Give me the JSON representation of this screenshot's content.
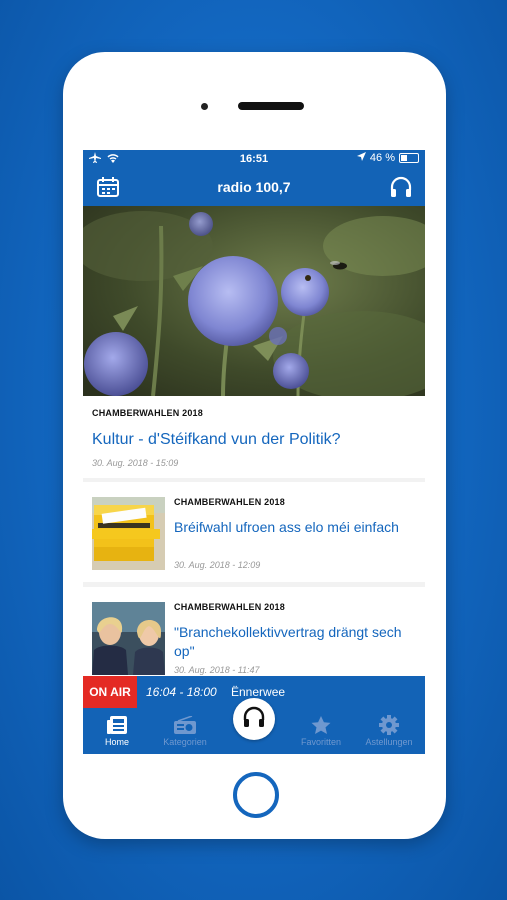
{
  "status_bar": {
    "time": "16:51",
    "battery": "46 %",
    "battery_level": 0.46
  },
  "nav": {
    "title": "radio 100,7",
    "calendar_icon": "calendar-icon",
    "headphones_icon": "headphones-icon"
  },
  "hero": {
    "category": "CHAMBERWAHLEN 2018",
    "title": "Kultur  - d'Stéifkand vun der Politik?",
    "date": "30. Aug. 2018 - 15:09"
  },
  "articles": [
    {
      "category": "CHAMBERWAHLEN 2018",
      "title": "Bréifwahl ufroen ass elo méi einfach",
      "date": "30. Aug. 2018 - 12:09"
    },
    {
      "category": "CHAMBERWAHLEN 2018",
      "title": "\"Branchekollektivvertrag drängt sech op\"",
      "date": "30. Aug. 2018 - 11:47"
    }
  ],
  "on_air": {
    "badge": "ON AIR",
    "time": "16:04 - 18:00",
    "show": "Ënnerwee"
  },
  "tabs": [
    {
      "label": "Home",
      "icon": "news-icon"
    },
    {
      "label": "Kategorien",
      "icon": "radio-icon"
    },
    {
      "label": "Favoritten",
      "icon": "star-icon"
    },
    {
      "label": "Astellungen",
      "icon": "gear-icon"
    }
  ],
  "colors": {
    "brand_blue": "#1363b6",
    "onair_red": "#e42a24",
    "link_blue": "#1466bd"
  }
}
